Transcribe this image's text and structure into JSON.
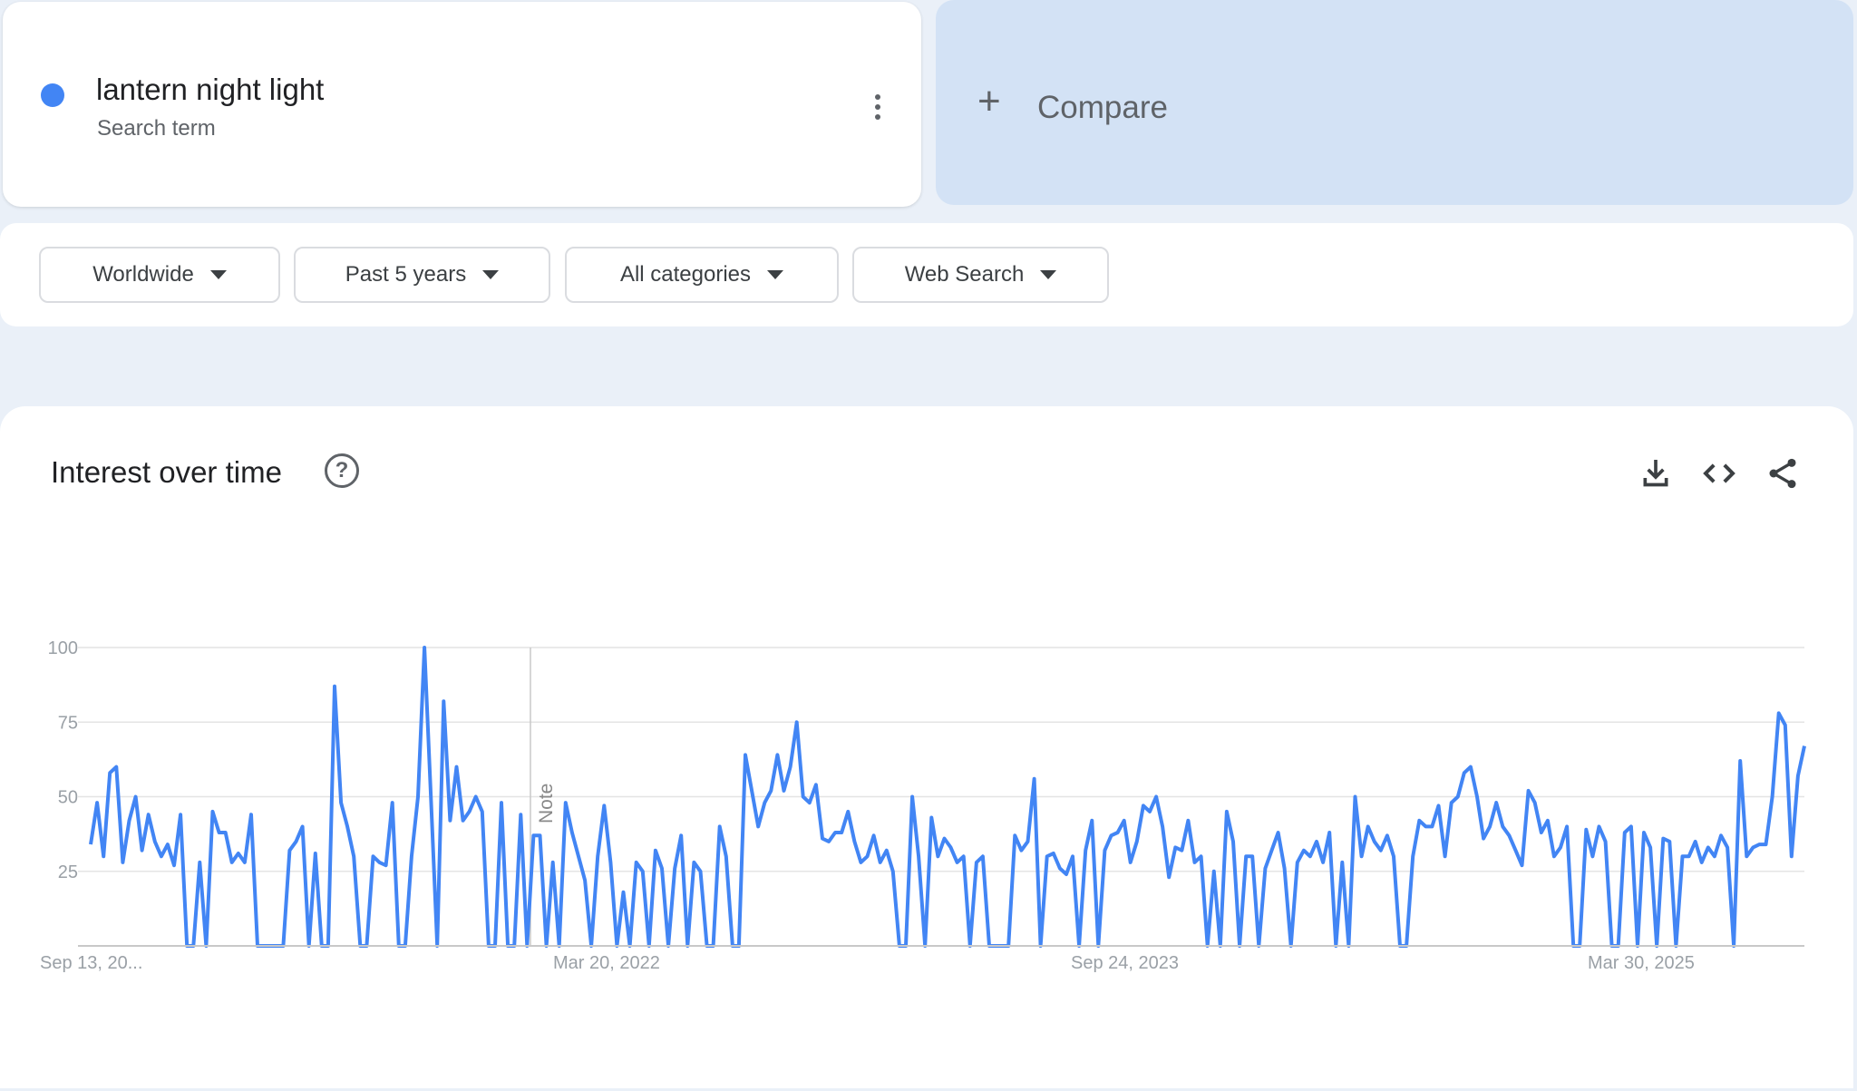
{
  "search_term": {
    "name": "lantern night light",
    "type": "Search term",
    "color": "#4285f4"
  },
  "compare": {
    "label": "Compare"
  },
  "filters": [
    {
      "label": "Worldwide"
    },
    {
      "label": "Past 5 years"
    },
    {
      "label": "All categories"
    },
    {
      "label": "Web Search"
    }
  ],
  "panel": {
    "title": "Interest over time",
    "icons": [
      "help-icon",
      "download-icon",
      "embed-icon",
      "share-icon"
    ]
  },
  "chart_data": {
    "type": "line",
    "title": "",
    "xlabel": "",
    "ylabel": "",
    "ylim": [
      0,
      100
    ],
    "yticks": [
      25,
      50,
      75,
      100
    ],
    "grid": true,
    "x_tick_labels": [
      "Sep 13, 20...",
      "Mar 20, 2022",
      "Sep 24, 2023",
      "Mar 30, 2025"
    ],
    "annotation": "Note",
    "series": [
      {
        "color": "#4285f4",
        "values": [
          34,
          48,
          30,
          58,
          60,
          28,
          42,
          50,
          32,
          44,
          35,
          30,
          34,
          27,
          44,
          0,
          0,
          28,
          0,
          45,
          38,
          38,
          28,
          31,
          28,
          44,
          0,
          0,
          0,
          0,
          0,
          32,
          35,
          40,
          0,
          31,
          0,
          0,
          87,
          48,
          40,
          30,
          0,
          0,
          30,
          28,
          27,
          48,
          0,
          0,
          30,
          50,
          100,
          50,
          0,
          82,
          42,
          60,
          42,
          45,
          50,
          45,
          0,
          0,
          48,
          0,
          0,
          44,
          0,
          37,
          37,
          0,
          28,
          0,
          48,
          38,
          30,
          22,
          0,
          30,
          47,
          28,
          0,
          18,
          0,
          28,
          25,
          0,
          32,
          26,
          0,
          26,
          37,
          0,
          28,
          25,
          0,
          0,
          40,
          30,
          0,
          0,
          64,
          52,
          40,
          48,
          52,
          64,
          52,
          60,
          75,
          50,
          48,
          54,
          36,
          35,
          38,
          38,
          45,
          35,
          28,
          30,
          37,
          28,
          32,
          25,
          0,
          0,
          50,
          30,
          0,
          43,
          30,
          36,
          33,
          28,
          30,
          0,
          28,
          30,
          0,
          0,
          0,
          0,
          37,
          32,
          35,
          56,
          0,
          30,
          31,
          26,
          24,
          30,
          0,
          32,
          42,
          0,
          32,
          37,
          38,
          42,
          28,
          35,
          47,
          45,
          50,
          40,
          23,
          33,
          32,
          42,
          28,
          30,
          0,
          25,
          0,
          45,
          35,
          0,
          30,
          30,
          0,
          26,
          32,
          38,
          26,
          0,
          28,
          32,
          30,
          35,
          28,
          38,
          0,
          28,
          0,
          50,
          30,
          40,
          35,
          32,
          37,
          30,
          0,
          0,
          30,
          42,
          40,
          40,
          47,
          30,
          48,
          50,
          58,
          60,
          50,
          36,
          40,
          48,
          40,
          37,
          32,
          27,
          52,
          48,
          38,
          42,
          30,
          33,
          40,
          0,
          0,
          39,
          30,
          40,
          35,
          0,
          0,
          38,
          40,
          0,
          38,
          33,
          0,
          36,
          35,
          0,
          30,
          30,
          35,
          28,
          33,
          30,
          37,
          33,
          0,
          62,
          30,
          33,
          34,
          34,
          50,
          78,
          74,
          30,
          57,
          67
        ]
      }
    ]
  }
}
